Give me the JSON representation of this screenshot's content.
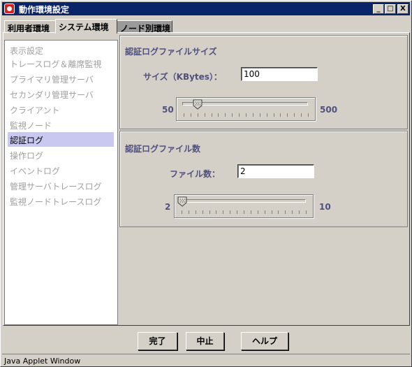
{
  "window": {
    "title": "動作環境設定",
    "min_label": "_",
    "max_label": "□",
    "close_label": "X"
  },
  "tabs": [
    {
      "label": "利用者環境"
    },
    {
      "label": "システム環境"
    },
    {
      "label": "ノード別環境"
    }
  ],
  "sidebar": {
    "items": [
      {
        "label": "表示設定"
      },
      {
        "label": "トレースログ＆離席監視"
      },
      {
        "label": "プライマリ管理サーバ"
      },
      {
        "label": "セカンダリ管理サーバ"
      },
      {
        "label": "クライアント"
      },
      {
        "label": "監視ノード"
      },
      {
        "label": "認証ログ"
      },
      {
        "label": "操作ログ"
      },
      {
        "label": "イベントログ"
      },
      {
        "label": "管理サーバトレースログ"
      },
      {
        "label": "監視ノードトレースログ"
      }
    ],
    "selected_index": 6
  },
  "log_size": {
    "title": "認証ログファイルサイズ",
    "label": "サイズ（KBytes）：",
    "value": "100",
    "min": "50",
    "max": "500",
    "slider_value": 100
  },
  "log_count": {
    "title": "認証ログファイル数",
    "label": "ファイル数：",
    "value": "2",
    "min": "2",
    "max": "10",
    "slider_value": 2
  },
  "buttons": {
    "ok": "完了",
    "cancel": "中止",
    "help": "ヘルプ"
  },
  "status": "Java Applet Window"
}
